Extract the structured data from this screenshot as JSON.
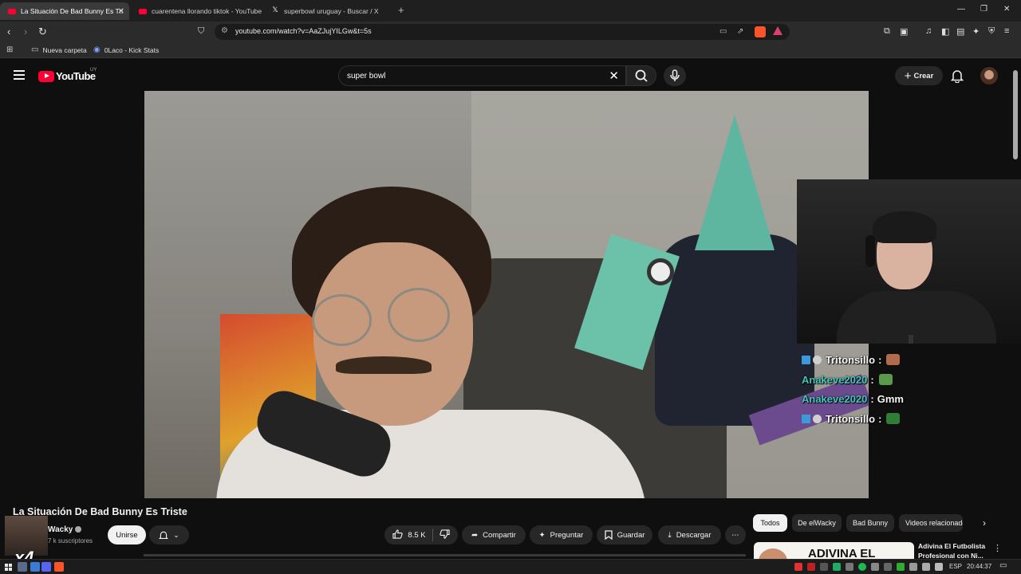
{
  "browser": {
    "tabs": [
      {
        "title": "La Situación De Bad Bunny Es Tri",
        "active": true,
        "favicon": "youtube-icon"
      },
      {
        "title": "cuarentena llorando tiktok - YouTube",
        "active": false,
        "favicon": "youtube-icon"
      },
      {
        "title": "superbowl uruguay - Buscar / X",
        "active": false,
        "favicon": "x-icon"
      }
    ],
    "new_tab": "+",
    "url": "youtube.com/watch?v=AaZJujYILGw&t=5s",
    "bookmarks": [
      {
        "label": "Nueva carpeta",
        "icon": "folder-icon"
      },
      {
        "label": "0Laco - Kick Stats",
        "icon": "kick-icon"
      }
    ]
  },
  "youtube": {
    "logo_text": "YouTube",
    "country_code": "UY",
    "search_query": "super bowl",
    "create_label": "Crear",
    "accent_color": "#ff0033"
  },
  "chat_overlay": [
    {
      "user": "Tritonsillo",
      "message": "",
      "color": "#f5f5f5",
      "badges": true,
      "emote": "meat"
    },
    {
      "user": "Anakeve2020",
      "message": "",
      "color": "#43c7ba",
      "badges": false,
      "emote": "frog"
    },
    {
      "user": "Anakeve2020",
      "message": "Gmm",
      "color": "#43c7ba",
      "badges": false,
      "emote": ""
    },
    {
      "user": "Tritonsillo",
      "message": "",
      "color": "#f5f5f5",
      "badges": true,
      "emote": "cap"
    }
  ],
  "video": {
    "title": "La Situación De Bad Bunny Es Triste",
    "channel": "Wacky",
    "channel_thumb_text": "x4",
    "subscribers": "7 k suscriptores",
    "join_label": "Unirse",
    "likes": "8.5 K",
    "share_label": "Compartir",
    "ask_label": "Preguntar",
    "save_label": "Guardar",
    "download_label": "Descargar"
  },
  "chips": [
    {
      "label": "Todos",
      "selected": true
    },
    {
      "label": "De elWacky",
      "selected": false
    },
    {
      "label": "Bad Bunny",
      "selected": false
    },
    {
      "label": "Videos relacionados",
      "selected": false
    }
  ],
  "recommended": {
    "thumb_text": "ADIVINA EL",
    "title": "Adivina El Futbolista Profesional con Ni..."
  },
  "taskbar": {
    "language": "ESP",
    "time": "20:44:37"
  }
}
